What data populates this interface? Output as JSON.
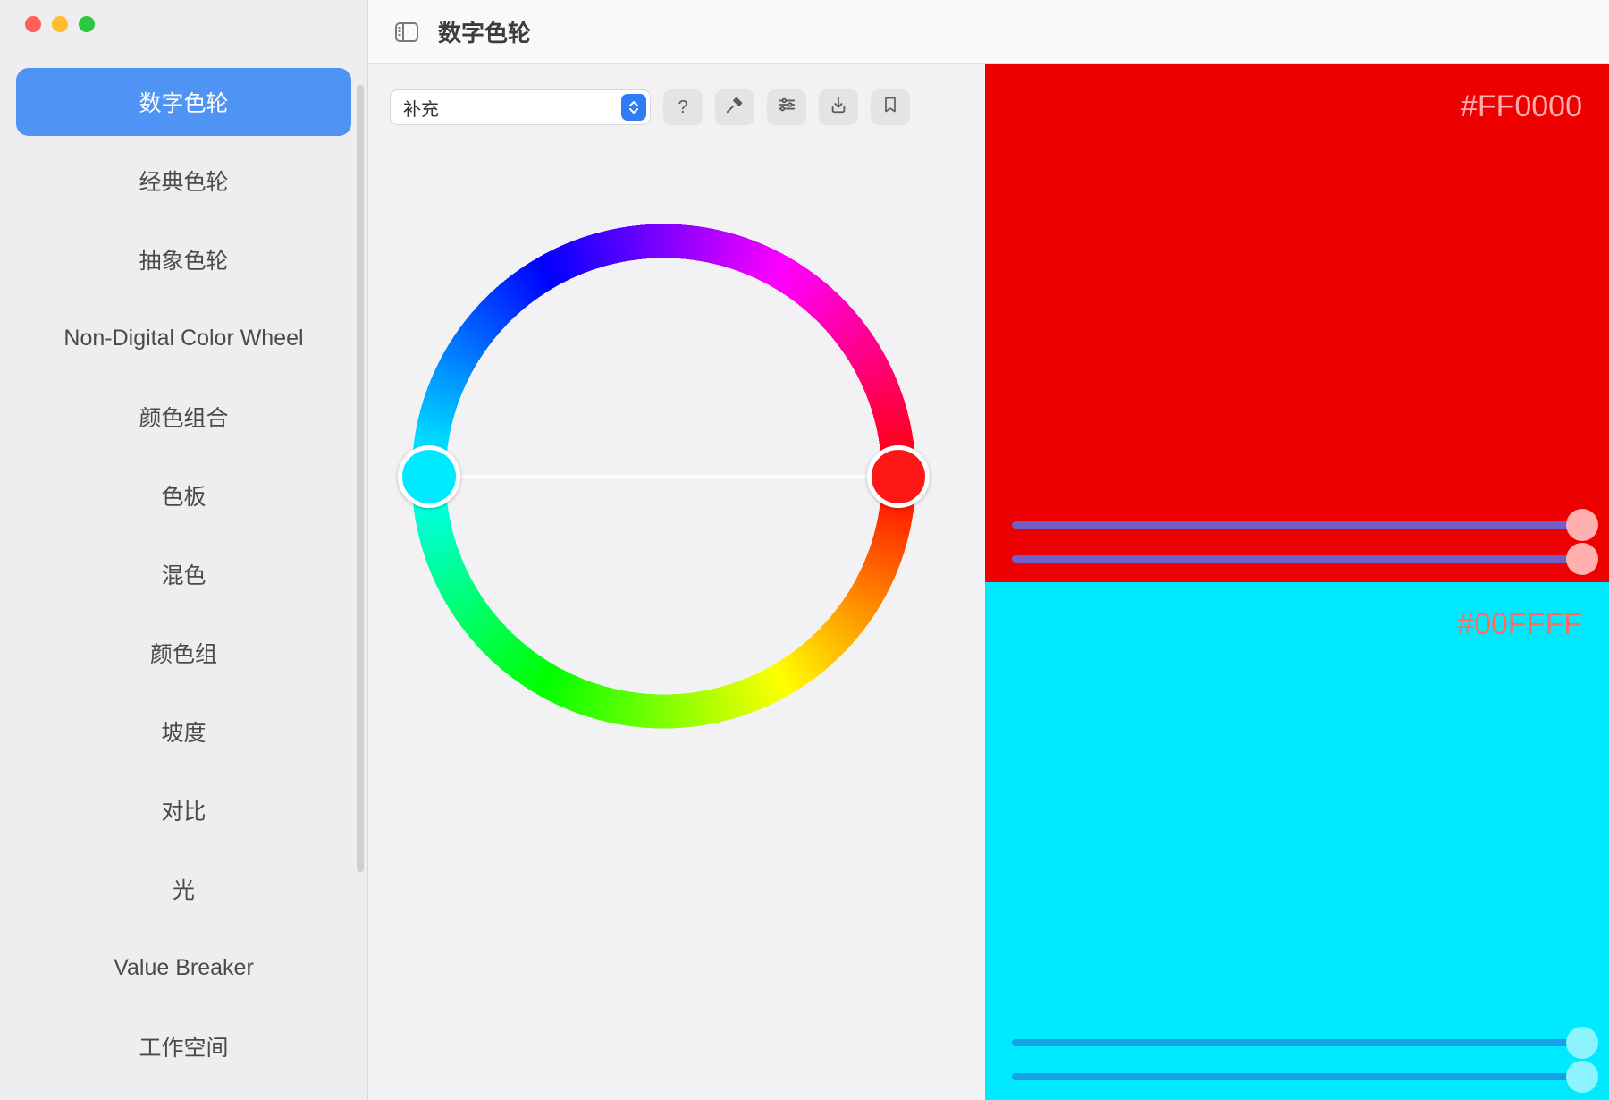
{
  "header": {
    "title": "数字色轮"
  },
  "sidebar": {
    "selected_index": 0,
    "items": [
      {
        "label": "数字色轮"
      },
      {
        "label": "经典色轮"
      },
      {
        "label": "抽象色轮"
      },
      {
        "label": "Non-Digital Color Wheel"
      },
      {
        "label": "颜色组合"
      },
      {
        "label": "色板"
      },
      {
        "label": "混色"
      },
      {
        "label": "颜色组"
      },
      {
        "label": "坡度"
      },
      {
        "label": "对比"
      },
      {
        "label": "光"
      },
      {
        "label": "Value Breaker"
      },
      {
        "label": "工作空间"
      }
    ]
  },
  "toolbar": {
    "harmony_dropdown": {
      "selected": "补充"
    },
    "buttons": {
      "help": "?",
      "eyedropper": "eyedropper-icon",
      "sliders": "sliders-icon",
      "export": "export-icon",
      "bookmark": "bookmark-icon"
    }
  },
  "wheel": {
    "handles": [
      {
        "color": "#00FFFF",
        "angle_deg": 180
      },
      {
        "color": "#FF0000",
        "angle_deg": 0
      }
    ]
  },
  "swatches": [
    {
      "hex": "#FF0000",
      "bg": "#ed0000",
      "label_color": "#ffaead",
      "slider_track": "#7160c9",
      "slider_thumb": "#ffb0af",
      "slider_values": [
        100,
        100
      ]
    },
    {
      "hex": "#00FFFF",
      "bg": "#00eaff",
      "label_color": "#ff6a5e",
      "slider_track": "#1a9ee8",
      "slider_thumb": "#8df4ff",
      "slider_values": [
        100,
        100
      ]
    }
  ]
}
